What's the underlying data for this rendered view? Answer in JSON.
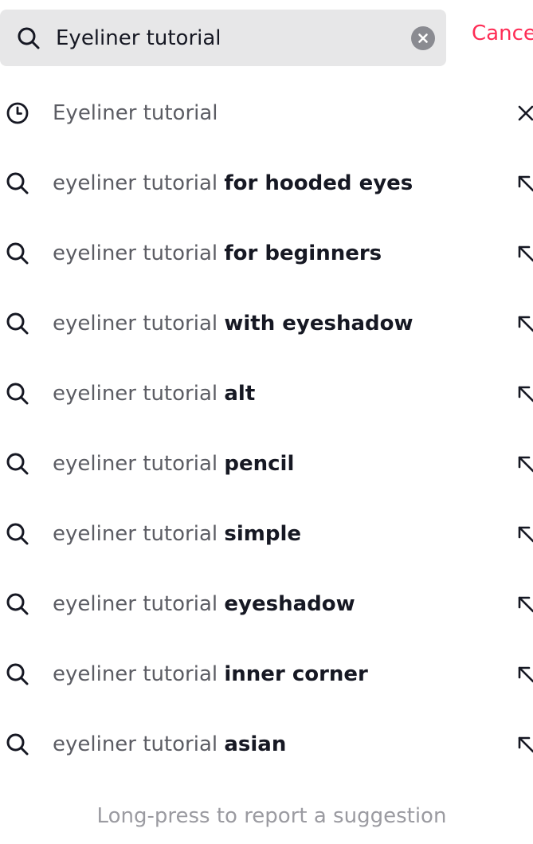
{
  "search": {
    "value": "Eyeliner tutorial",
    "cancel_label": "Cancel",
    "icon": "search-icon",
    "clear_icon": "clear-circle-icon"
  },
  "history": [
    {
      "text": "Eyeliner tutorial",
      "icon": "history-clock-icon",
      "action_icon": "remove-x-icon"
    }
  ],
  "suggestions": [
    {
      "prefix": "eyeliner tutorial ",
      "completion": "for hooded eyes",
      "icon": "search-icon",
      "action_icon": "fill-arrow-icon"
    },
    {
      "prefix": "eyeliner tutorial ",
      "completion": "for beginners",
      "icon": "search-icon",
      "action_icon": "fill-arrow-icon"
    },
    {
      "prefix": "eyeliner tutorial ",
      "completion": "with eyeshadow",
      "icon": "search-icon",
      "action_icon": "fill-arrow-icon"
    },
    {
      "prefix": "eyeliner tutorial ",
      "completion": "alt",
      "icon": "search-icon",
      "action_icon": "fill-arrow-icon"
    },
    {
      "prefix": "eyeliner tutorial ",
      "completion": "pencil",
      "icon": "search-icon",
      "action_icon": "fill-arrow-icon"
    },
    {
      "prefix": "eyeliner tutorial ",
      "completion": "simple",
      "icon": "search-icon",
      "action_icon": "fill-arrow-icon"
    },
    {
      "prefix": "eyeliner tutorial ",
      "completion": "eyeshadow",
      "icon": "search-icon",
      "action_icon": "fill-arrow-icon"
    },
    {
      "prefix": "eyeliner tutorial ",
      "completion": "inner corner",
      "icon": "search-icon",
      "action_icon": "fill-arrow-icon"
    },
    {
      "prefix": "eyeliner tutorial ",
      "completion": "asian",
      "icon": "search-icon",
      "action_icon": "fill-arrow-icon"
    }
  ],
  "footer": {
    "hint": "Long-press to report a suggestion"
  },
  "colors": {
    "accent": "#fe2c55",
    "search_bg": "#e7e7e8",
    "text_primary": "#161823",
    "text_secondary": "#5c5d64",
    "text_hint": "#9b9ba1"
  }
}
